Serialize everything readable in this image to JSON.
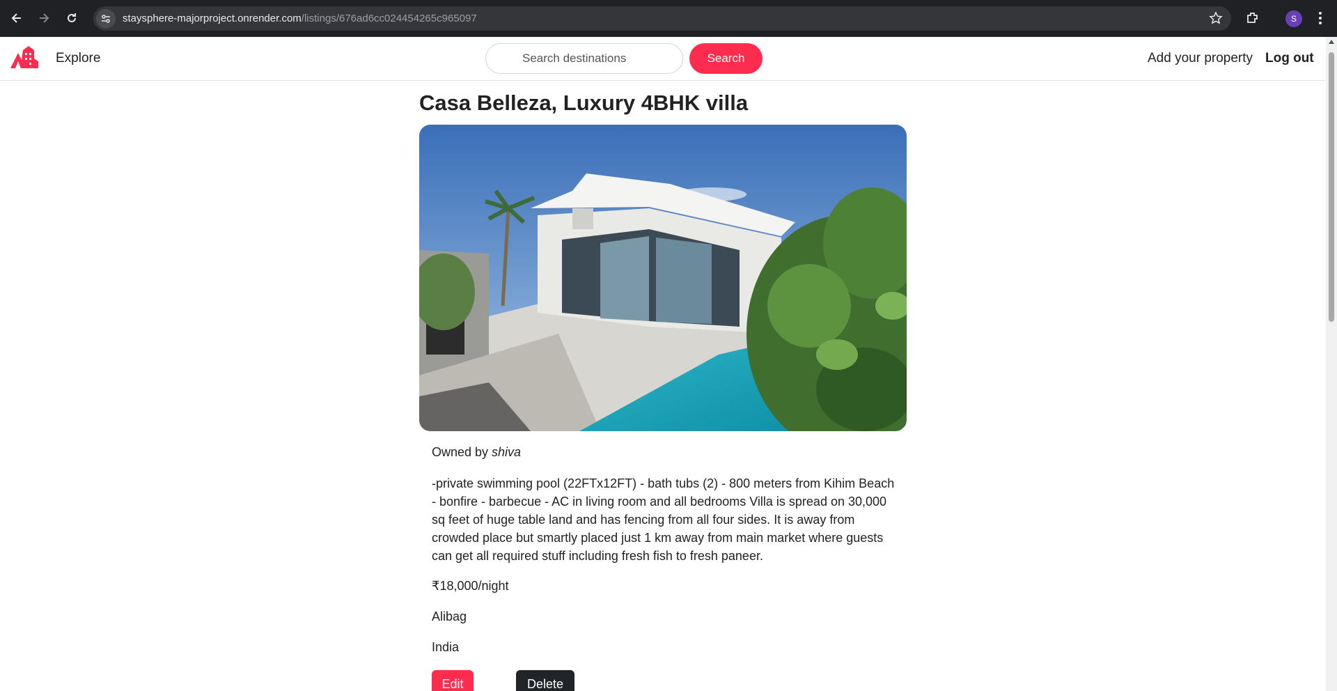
{
  "browser": {
    "url_host": "staysphere-majorproject.onrender.com",
    "url_path": "/listings/676ad6cc024454265c965097",
    "profile_initial": "S",
    "icons": [
      "back-icon",
      "forward-icon",
      "reload-icon",
      "site-info-icon",
      "bookmark-star-icon",
      "extensions-icon",
      "menu-dots-icon"
    ]
  },
  "navbar": {
    "explore_label": "Explore",
    "search_placeholder": "Search destinations",
    "search_button": "Search",
    "add_property": "Add your property",
    "logout": "Log out",
    "brand_color": "#fe2d4f"
  },
  "listing": {
    "title": "Casa Belleza, Luxury 4BHK villa",
    "owned_prefix": "Owned by ",
    "owner": "shiva",
    "description": "-private swimming pool (22FTx12FT) - bath tubs (2) - 800 meters from Kihim Beach - bonfire - barbecue - AC in living room and all bedrooms Villa is spread on 30,000 sq feet of huge table land and has fencing from all four sides. It is away from crowded place but smartly placed just 1 km away from main market where guests can get all required stuff including fresh fish to fresh paneer.",
    "price": "₹18,000/night",
    "location": "Alibag",
    "country": "India",
    "edit_label": "Edit",
    "delete_label": "Delete"
  }
}
